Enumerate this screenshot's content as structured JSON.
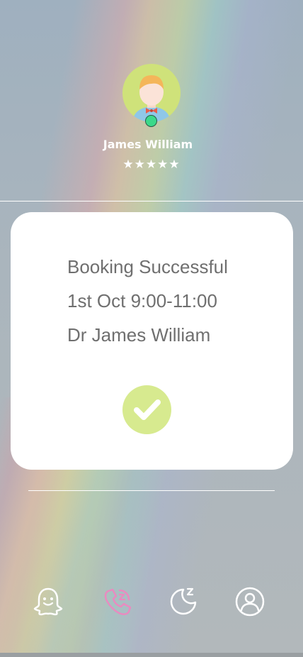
{
  "profile": {
    "name": "James William",
    "rating_stars": "★★★★★",
    "rating": 5,
    "online_status_color": "#3bd98a"
  },
  "booking": {
    "title": "Booking Successful",
    "datetime": "1st Oct 9:00-11:00",
    "doctor": "Dr James William",
    "confirm_icon": "check-icon"
  },
  "nav": {
    "items": [
      {
        "icon": "ghost-icon",
        "active": false
      },
      {
        "icon": "phone-icon",
        "active": true,
        "color": "#e98bc0"
      },
      {
        "icon": "moon-sleep-icon",
        "active": false
      },
      {
        "icon": "user-profile-icon",
        "active": false
      }
    ]
  },
  "colors": {
    "accent_green": "#d7ea8f",
    "avatar_bg": "#cfe27a",
    "text_gray": "#6f6f6f"
  }
}
